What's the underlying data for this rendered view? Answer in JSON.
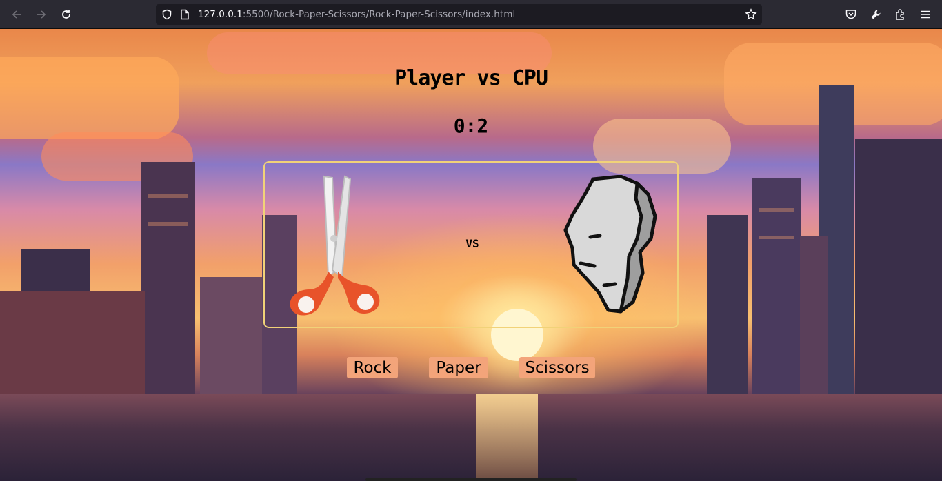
{
  "browser": {
    "url_host": "127.0.0.1",
    "url_rest": ":5500/Rock-Paper-Scissors/Rock-Paper-Scissors/index.html",
    "icons": [
      "back-icon",
      "forward-icon",
      "reload-icon",
      "shield-icon",
      "page-icon",
      "star-icon",
      "pocket-icon",
      "wrench-icon",
      "extensions-icon",
      "menu-icon"
    ]
  },
  "game": {
    "title": "Player vs CPU",
    "score": "0:2",
    "vs_label": "VS",
    "player_choice": "scissors",
    "cpu_choice": "rock",
    "buttons": {
      "rock": "Rock",
      "paper": "Paper",
      "scissors": "Scissors"
    }
  },
  "colors": {
    "arena_border": "#f1d278",
    "button_bg": "#f3a47a",
    "scissor_handle": "#e8532a",
    "rock_fill": "#d9d9d9"
  }
}
